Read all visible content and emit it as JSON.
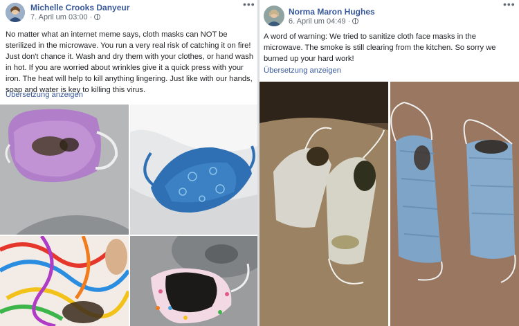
{
  "post_left": {
    "author": "Michelle Crooks Danyeur",
    "timestamp": "7. April um 03:00 ·",
    "more_icon": "more-horizontal-icon",
    "audience_icon": "globe-icon",
    "body": "No matter what an internet meme says, cloth masks can NOT be sterilized in the microwave. You run a very real risk of catching it on fire! Just don't chance it. Wash and dry them with your clothes, or hand wash in hot. If you are worried about wrinkles give it a quick press with your iron. The heat will help to kill anything lingering. Just like with our hands, soap and water is key to killing this virus.",
    "translate_link": "Übersetzung anzeigen"
  },
  "post_right": {
    "author": "Norma Maron Hughes",
    "timestamp": "6. April um 04:49 ·",
    "more_icon": "more-horizontal-icon",
    "audience_icon": "globe-icon",
    "body": "A word of warning: We tried to sanitize cloth face masks in the microwave. The smoke is still clearing from the kitchen. So sorry we burned up your hard work!",
    "translate_link": "Übersetzung anzeigen"
  },
  "colors": {
    "link": "#385898",
    "text": "#1c1e21",
    "meta": "#606770"
  }
}
